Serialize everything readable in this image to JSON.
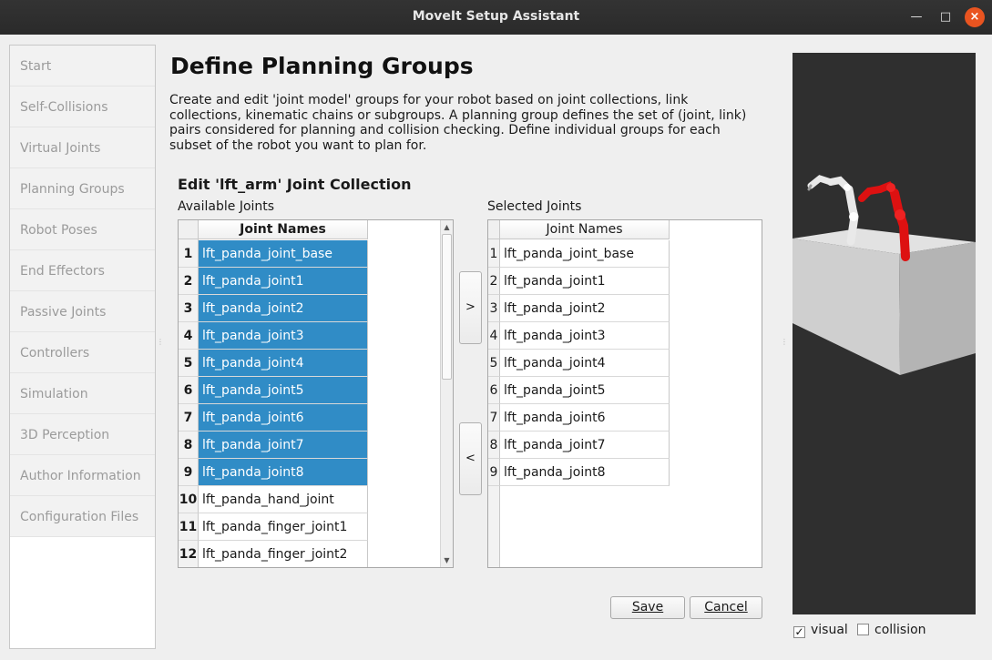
{
  "window": {
    "title": "MoveIt Setup Assistant"
  },
  "nav": {
    "items": [
      {
        "label": "Start"
      },
      {
        "label": "Self-Collisions"
      },
      {
        "label": "Virtual Joints"
      },
      {
        "label": "Planning Groups"
      },
      {
        "label": "Robot Poses"
      },
      {
        "label": "End Effectors"
      },
      {
        "label": "Passive Joints"
      },
      {
        "label": "Controllers"
      },
      {
        "label": "Simulation"
      },
      {
        "label": "3D Perception"
      },
      {
        "label": "Author Information"
      },
      {
        "label": "Configuration Files"
      }
    ]
  },
  "page": {
    "title": "Define Planning Groups",
    "description": "Create and edit 'joint model' groups for your robot based on joint collections, link collections, kinematic chains or subgroups. A planning group defines the set of (joint, link) pairs considered for planning and collision checking. Define individual groups for each subset of the robot you want to plan for."
  },
  "editor": {
    "section_title": "Edit 'lft_arm' Joint Collection",
    "available_label": "Available Joints",
    "selected_label": "Selected Joints",
    "column_header": "Joint Names",
    "available_joints": [
      {
        "num": "1",
        "name": "lft_panda_joint_base",
        "selected": true
      },
      {
        "num": "2",
        "name": "lft_panda_joint1",
        "selected": true
      },
      {
        "num": "3",
        "name": "lft_panda_joint2",
        "selected": true
      },
      {
        "num": "4",
        "name": "lft_panda_joint3",
        "selected": true
      },
      {
        "num": "5",
        "name": "lft_panda_joint4",
        "selected": true
      },
      {
        "num": "6",
        "name": "lft_panda_joint5",
        "selected": true
      },
      {
        "num": "7",
        "name": "lft_panda_joint6",
        "selected": true
      },
      {
        "num": "8",
        "name": "lft_panda_joint7",
        "selected": true
      },
      {
        "num": "9",
        "name": "lft_panda_joint8",
        "selected": true
      },
      {
        "num": "10",
        "name": "lft_panda_hand_joint",
        "selected": false
      },
      {
        "num": "11",
        "name": "lft_panda_finger_joint1",
        "selected": false
      },
      {
        "num": "12",
        "name": "lft_panda_finger_joint2",
        "selected": false
      }
    ],
    "selected_joints": [
      {
        "num": "1",
        "name": "lft_panda_joint_base"
      },
      {
        "num": "2",
        "name": "lft_panda_joint1"
      },
      {
        "num": "3",
        "name": "lft_panda_joint2"
      },
      {
        "num": "4",
        "name": "lft_panda_joint3"
      },
      {
        "num": "5",
        "name": "lft_panda_joint4"
      },
      {
        "num": "6",
        "name": "lft_panda_joint5"
      },
      {
        "num": "7",
        "name": "lft_panda_joint6"
      },
      {
        "num": "8",
        "name": "lft_panda_joint7"
      },
      {
        "num": "9",
        "name": "lft_panda_joint8"
      }
    ],
    "add_label": ">",
    "remove_label": "<",
    "save_label": "Save",
    "cancel_label": "Cancel"
  },
  "viewer": {
    "visual_label": "visual",
    "visual_checked": true,
    "collision_label": "collision",
    "collision_checked": false,
    "highlight_color": "#dd1111",
    "table_color": "#dcdcdc"
  },
  "colors": {
    "selection": "#308cc6",
    "close_button": "#e95420"
  }
}
